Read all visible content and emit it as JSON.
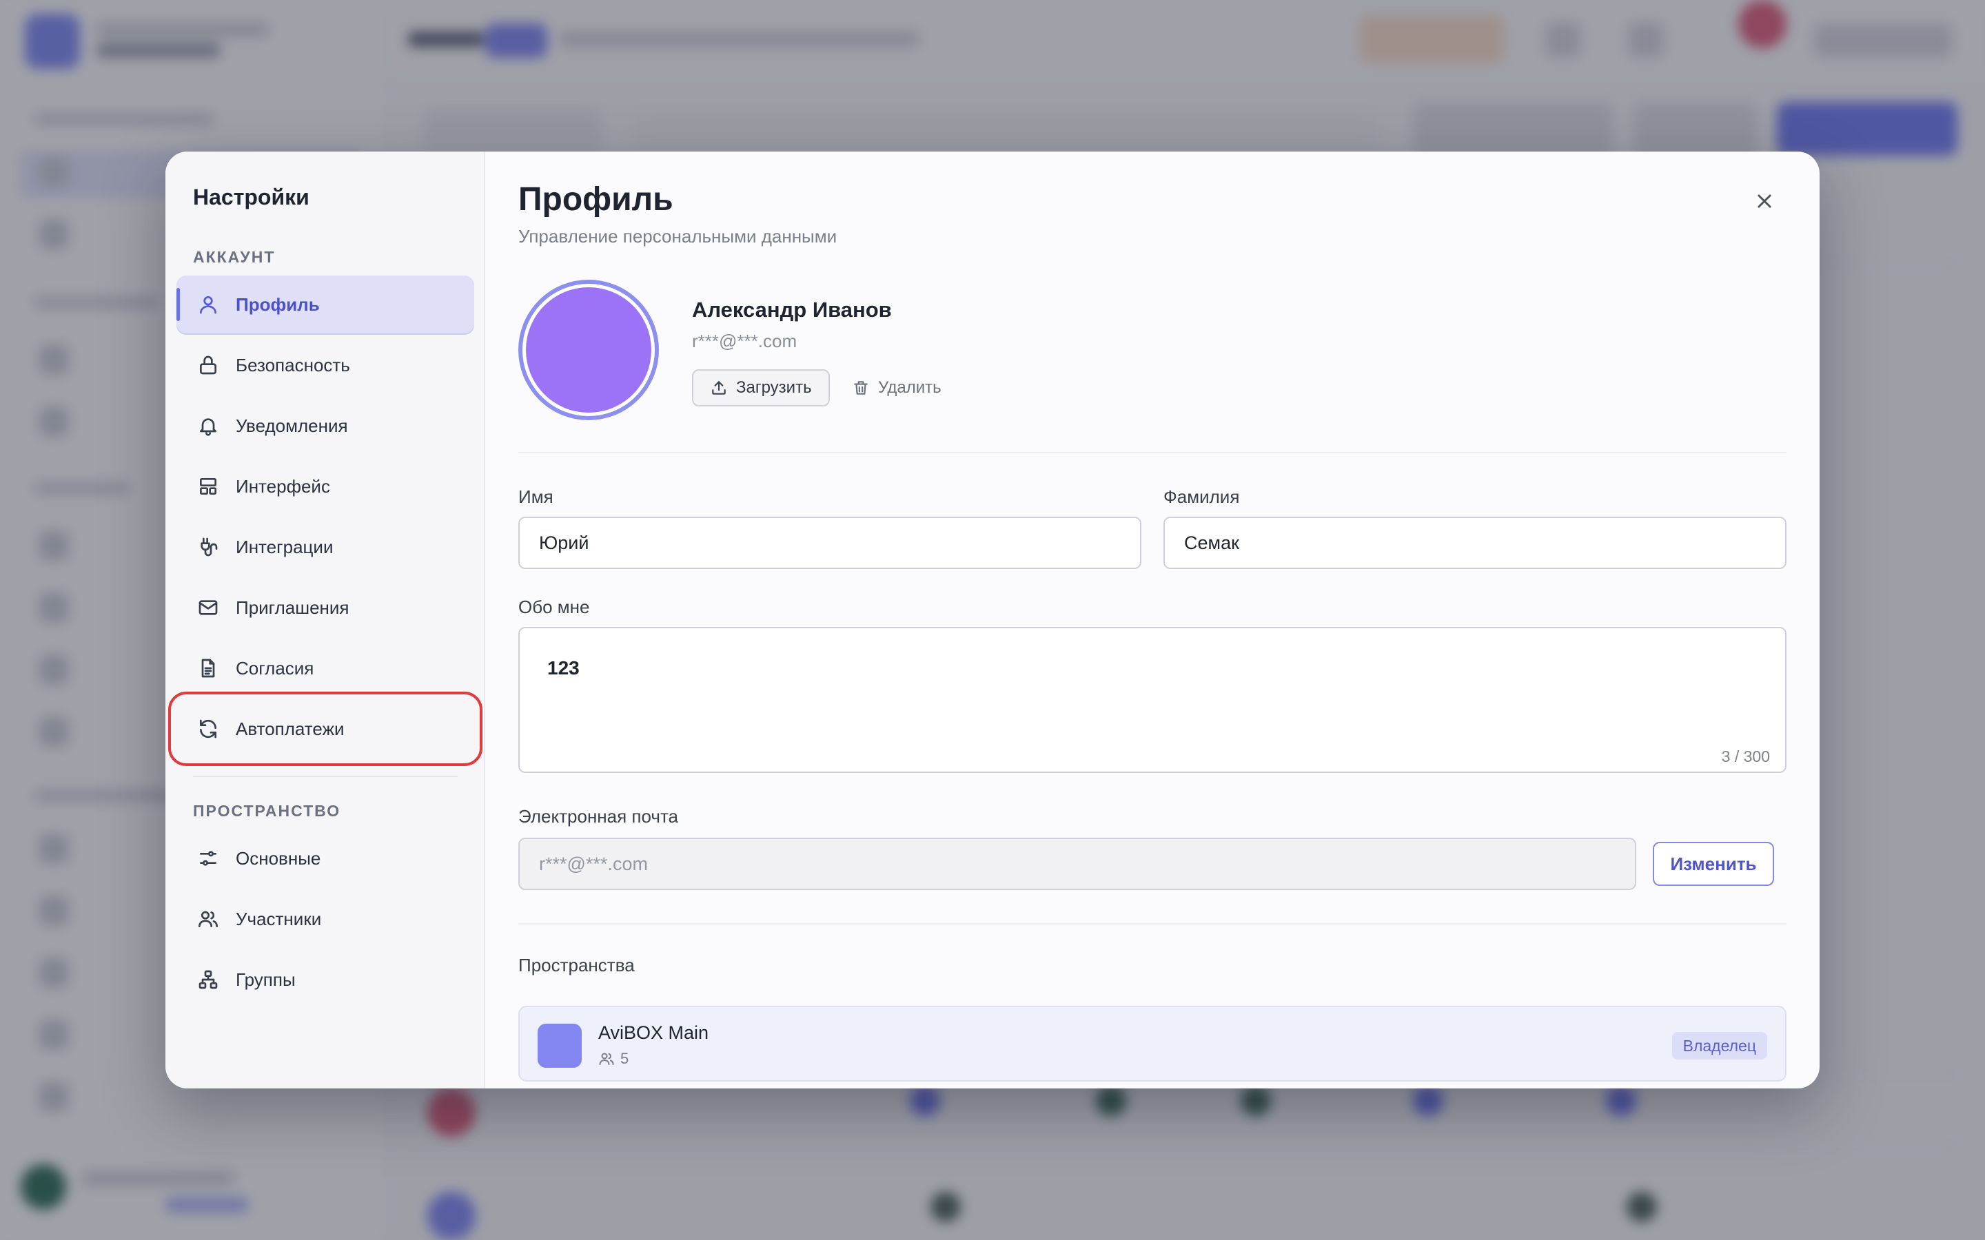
{
  "settings": {
    "title": "Настройки",
    "sections": {
      "account": "АККАУНТ",
      "space": "ПРОСТРАНСТВО"
    },
    "account_items": [
      {
        "label": "Профиль",
        "icon": "user-icon",
        "active": true
      },
      {
        "label": "Безопасность",
        "icon": "lock-icon"
      },
      {
        "label": "Уведомления",
        "icon": "bell-icon"
      },
      {
        "label": "Интерфейс",
        "icon": "layout-icon"
      },
      {
        "label": "Интеграции",
        "icon": "plug-icon"
      },
      {
        "label": "Приглашения",
        "icon": "mail-icon"
      },
      {
        "label": "Согласия",
        "icon": "document-icon"
      },
      {
        "label": "Автоплатежи",
        "icon": "refresh-icon",
        "highlighted": true
      }
    ],
    "space_items": [
      {
        "label": "Основные",
        "icon": "sliders-icon"
      },
      {
        "label": "Участники",
        "icon": "users-icon"
      },
      {
        "label": "Группы",
        "icon": "hierarchy-icon"
      }
    ]
  },
  "profile": {
    "title": "Профиль",
    "subtitle": "Управление персональными данными",
    "user_name": "Александр Иванов",
    "user_email": "r***@***.com",
    "upload_label": "Загрузить",
    "delete_label": "Удалить",
    "first_name_label": "Имя",
    "first_name_value": "Юрий",
    "last_name_label": "Фамилия",
    "last_name_value": "Семак",
    "about_label": "Обо мне",
    "about_value": "123",
    "about_counter": "3 / 300",
    "email_label": "Электронная почта",
    "email_value": "r***@***.com",
    "change_label": "Изменить",
    "spaces_label": "Пространства",
    "space": {
      "name": "AviBOX Main",
      "members": "5",
      "role": "Владелец"
    }
  },
  "colors": {
    "accent": "#6b70e6",
    "avatar": "#9c73f6",
    "highlight": "#e23b3b"
  }
}
